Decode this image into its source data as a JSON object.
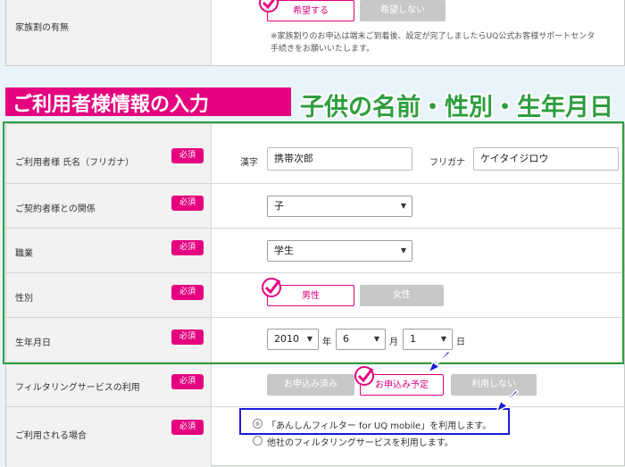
{
  "family_discount": {
    "label": "家族割の有無",
    "btn_yes": "希望する",
    "btn_no": "希望しない",
    "note_line1": "※家族割りのお申込は端末ご到着後、設定が完了しましたらUQ公式お客様サポートセンタ",
    "note_line2": "手続きをお願いいたします。"
  },
  "banner": {
    "title": "ご利用者様情報の入力",
    "caption": "子供の名前・性別・生年月日"
  },
  "required_badge": "必須",
  "form": {
    "name": {
      "label": "ご利用者様 氏名（フリガナ）",
      "kanji_label": "漢字",
      "kanji_value": "携帯次郎",
      "kana_label": "フリガナ",
      "kana_value": "ケイタイジロウ"
    },
    "relation": {
      "label": "ご契約者様との関係",
      "value": "子"
    },
    "occupation": {
      "label": "職業",
      "value": "学生"
    },
    "gender": {
      "label": "性別",
      "male": "男性",
      "female": "女性"
    },
    "birthday": {
      "label": "生年月日",
      "year": "2010",
      "year_unit": "年",
      "month": "6",
      "month_unit": "月",
      "day": "1",
      "day_unit": "日"
    },
    "filtering": {
      "label": "フィルタリングサービスの利用",
      "btn_applied": "お申込み済み",
      "btn_planned": "お申込み予定",
      "btn_none": "利用しない"
    },
    "usage_case": {
      "label": "ご利用される場合",
      "option1": "「あんしんフィルター for UQ mobile」を利用します。",
      "option2": "他社のフィルタリングサービスを利用します。"
    }
  },
  "colors": {
    "accent": "#e4007f",
    "highlight_green": "#2e9e3e",
    "highlight_blue": "#1a1adc"
  }
}
